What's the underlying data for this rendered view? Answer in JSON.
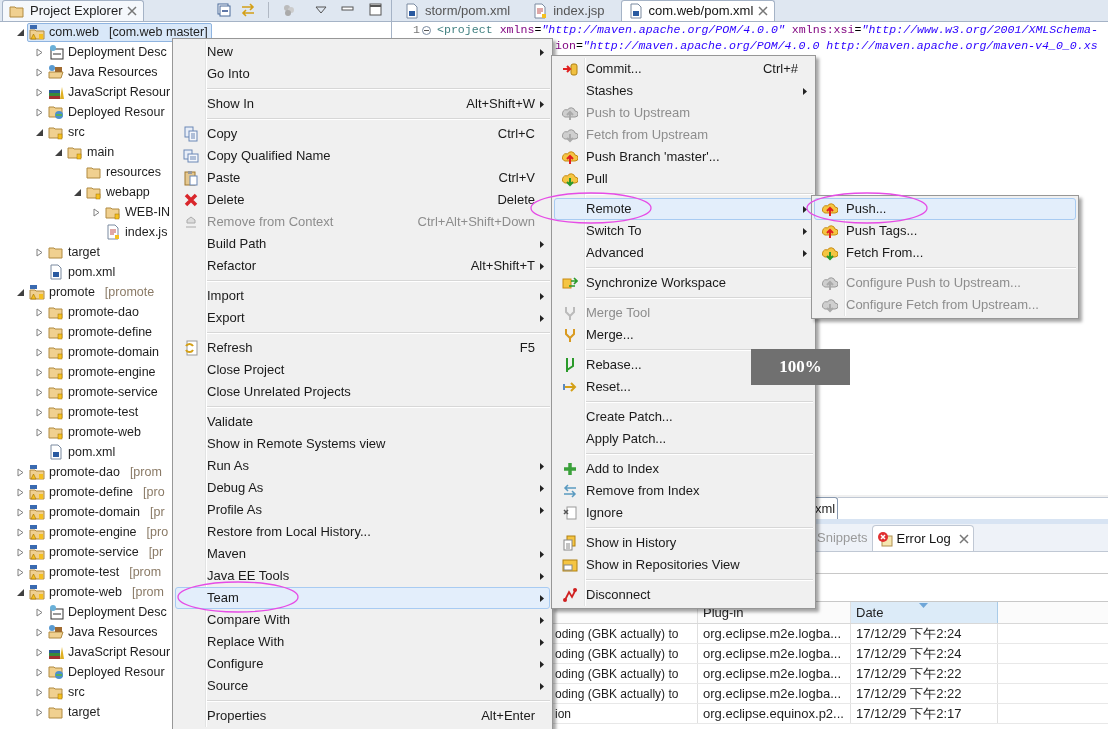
{
  "explorer": {
    "title": "Project Explorer",
    "tree": [
      {
        "label": "com.web",
        "decoration": "[com.web master]",
        "kind": "project",
        "expanded": true,
        "selected": true,
        "children": [
          {
            "label": "Deployment Desc",
            "kind": "deployment-descriptor",
            "expanded": false,
            "selected": false
          },
          {
            "label": "Java Resources",
            "kind": "java-resources",
            "expanded": false,
            "selected": false
          },
          {
            "label": "JavaScript Resour",
            "kind": "javascript-resources",
            "expanded": false,
            "selected": false
          },
          {
            "label": "Deployed Resour",
            "kind": "deployed-resources",
            "expanded": false,
            "selected": false
          },
          {
            "label": "src",
            "kind": "folder",
            "expanded": true,
            "selected": false,
            "children": [
              {
                "label": "main",
                "kind": "folder",
                "expanded": true,
                "selected": false,
                "children": [
                  {
                    "label": "resources",
                    "kind": "plain-folder",
                    "selected": false
                  },
                  {
                    "label": "webapp",
                    "kind": "folder",
                    "expanded": true,
                    "selected": false,
                    "children": [
                      {
                        "label": "WEB-IN",
                        "kind": "folder",
                        "expanded": false,
                        "selected": false
                      },
                      {
                        "label": "index.js",
                        "kind": "jsp-file",
                        "selected": false
                      }
                    ]
                  }
                ]
              }
            ]
          },
          {
            "label": "target",
            "kind": "plain-folder",
            "expanded": false,
            "selected": false
          },
          {
            "label": "pom.xml",
            "kind": "pom-file",
            "selected": false
          }
        ]
      },
      {
        "label": "promote",
        "decoration": "[promote",
        "kind": "project",
        "expanded": true,
        "selected": false,
        "children": [
          {
            "label": "promote-dao",
            "kind": "folder",
            "expanded": false,
            "selected": false
          },
          {
            "label": "promote-define",
            "kind": "folder",
            "expanded": false,
            "selected": false
          },
          {
            "label": "promote-domain",
            "kind": "folder",
            "expanded": false,
            "selected": false
          },
          {
            "label": "promote-engine",
            "kind": "folder",
            "expanded": false,
            "selected": false
          },
          {
            "label": "promote-service",
            "kind": "folder",
            "expanded": false,
            "selected": false
          },
          {
            "label": "promote-test",
            "kind": "folder",
            "expanded": false,
            "selected": false
          },
          {
            "label": "promote-web",
            "kind": "folder",
            "expanded": false,
            "selected": false
          },
          {
            "label": "pom.xml",
            "kind": "pom-file",
            "selected": false
          }
        ]
      },
      {
        "label": "promote-dao",
        "decoration": "[prom",
        "kind": "project",
        "expanded": false,
        "selected": false
      },
      {
        "label": "promote-define",
        "decoration": "[pro",
        "kind": "project",
        "expanded": false,
        "selected": false
      },
      {
        "label": "promote-domain",
        "decoration": "[pr",
        "kind": "project",
        "expanded": false,
        "selected": false
      },
      {
        "label": "promote-engine",
        "decoration": "[pro",
        "kind": "project",
        "expanded": false,
        "selected": false
      },
      {
        "label": "promote-service",
        "decoration": "[pr",
        "kind": "project",
        "expanded": false,
        "selected": false
      },
      {
        "label": "promote-test",
        "decoration": "[prom",
        "kind": "project",
        "expanded": false,
        "selected": false
      },
      {
        "label": "promote-web",
        "decoration": "[prom",
        "kind": "project",
        "expanded": true,
        "selected": false,
        "children": [
          {
            "label": "Deployment Desc",
            "kind": "deployment-descriptor",
            "expanded": false,
            "selected": false
          },
          {
            "label": "Java Resources",
            "kind": "java-resources",
            "expanded": false,
            "selected": false
          },
          {
            "label": "JavaScript Resour",
            "kind": "javascript-resources",
            "expanded": false,
            "selected": false
          },
          {
            "label": "Deployed Resour",
            "kind": "deployed-resources",
            "expanded": false,
            "selected": false
          },
          {
            "label": "src",
            "kind": "folder",
            "expanded": false,
            "selected": false
          },
          {
            "label": "target",
            "kind": "plain-folder",
            "expanded": false,
            "selected": false
          }
        ]
      }
    ]
  },
  "editor": {
    "tabs": [
      {
        "label": "storm/pom.xml",
        "kind": "pom-file",
        "selected": false
      },
      {
        "label": "index.jsp",
        "kind": "jsp-file",
        "selected": false
      },
      {
        "label": "com.web/pom.xml",
        "kind": "pom-file",
        "selected": true
      }
    ],
    "lines": [
      {
        "number": "1",
        "segments": [
          {
            "kind": "tag",
            "text": "<project"
          },
          {
            "kind": "attr",
            "text": " xmlns"
          },
          {
            "kind": "plain",
            "text": "="
          },
          {
            "kind": "string",
            "text": "\"http://maven.apache.org/POM/4.0.0\""
          },
          {
            "kind": "attr",
            "text": " xmlns:xsi"
          },
          {
            "kind": "plain",
            "text": "="
          },
          {
            "kind": "string",
            "text": "\"http://www.w3.org/2001/XMLSchema-"
          }
        ]
      },
      {
        "segments": [
          {
            "kind": "attr",
            "text": "ion"
          },
          {
            "kind": "plain",
            "text": "="
          },
          {
            "kind": "string",
            "text": "\"http://maven.apache.org/POM/4.0.0 http://maven.apache.org/maven-v4_0_0.xs"
          }
        ]
      }
    ],
    "page_tabs": [
      {
        "label": "xml",
        "selected": true
      }
    ]
  },
  "bottom_panel": {
    "tabs": [
      {
        "label": "Snippets",
        "selected": false
      },
      {
        "label": "Error Log",
        "selected": true
      }
    ],
    "columns": [
      {
        "sorted": false
      },
      {
        "label": "Plug-in",
        "sorted": false
      },
      {
        "label": "Date",
        "sorted": true
      }
    ],
    "rows": [
      [
        "oding (GBK actually) to",
        "org.eclipse.m2e.logba...",
        "17/12/29 下午2:24"
      ],
      [
        "oding (GBK actually) to",
        "org.eclipse.m2e.logba...",
        "17/12/29 下午2:24"
      ],
      [
        "oding (GBK actually) to",
        "org.eclipse.m2e.logba...",
        "17/12/29 下午2:22"
      ],
      [
        "oding (GBK actually) to",
        "org.eclipse.m2e.logba...",
        "17/12/29 下午2:22"
      ],
      [
        "ion",
        "org.eclipse.equinox.p2...",
        "17/12/29 下午2:17"
      ]
    ]
  },
  "context_menu": {
    "items": [
      {
        "kind": "item",
        "label": "New",
        "submenu": true,
        "disabled": false,
        "selected": false,
        "circled": false
      },
      {
        "kind": "item",
        "label": "Go Into",
        "submenu": false,
        "disabled": false,
        "selected": false,
        "circled": false
      },
      {
        "kind": "separator"
      },
      {
        "kind": "item",
        "label": "Show In",
        "shortcut": "Alt+Shift+W",
        "submenu": true,
        "disabled": false,
        "selected": false,
        "circled": false
      },
      {
        "kind": "separator"
      },
      {
        "kind": "item",
        "label": "Copy",
        "shortcut": "Ctrl+C",
        "submenu": false,
        "disabled": false,
        "selected": false,
        "circled": false
      },
      {
        "kind": "item",
        "label": "Copy Qualified Name",
        "submenu": false,
        "disabled": false,
        "selected": false,
        "circled": false
      },
      {
        "kind": "item",
        "label": "Paste",
        "shortcut": "Ctrl+V",
        "submenu": false,
        "disabled": false,
        "selected": false,
        "circled": false
      },
      {
        "kind": "item",
        "label": "Delete",
        "shortcut": "Delete",
        "submenu": false,
        "disabled": false,
        "selected": false,
        "circled": false
      },
      {
        "kind": "item",
        "label": "Remove from Context",
        "shortcut": "Ctrl+Alt+Shift+Down",
        "submenu": false,
        "disabled": true,
        "selected": false,
        "circled": false
      },
      {
        "kind": "item",
        "label": "Build Path",
        "submenu": true,
        "disabled": false,
        "selected": false,
        "circled": false
      },
      {
        "kind": "item",
        "label": "Refactor",
        "shortcut": "Alt+Shift+T",
        "submenu": true,
        "disabled": false,
        "selected": false,
        "circled": false
      },
      {
        "kind": "separator"
      },
      {
        "kind": "item",
        "label": "Import",
        "submenu": true,
        "disabled": false,
        "selected": false,
        "circled": false
      },
      {
        "kind": "item",
        "label": "Export",
        "submenu": true,
        "disabled": false,
        "selected": false,
        "circled": false
      },
      {
        "kind": "separator"
      },
      {
        "kind": "item",
        "label": "Refresh",
        "shortcut": "F5",
        "submenu": false,
        "disabled": false,
        "selected": false,
        "circled": false
      },
      {
        "kind": "item",
        "label": "Close Project",
        "submenu": false,
        "disabled": false,
        "selected": false,
        "circled": false
      },
      {
        "kind": "item",
        "label": "Close Unrelated Projects",
        "submenu": false,
        "disabled": false,
        "selected": false,
        "circled": false
      },
      {
        "kind": "separator"
      },
      {
        "kind": "item",
        "label": "Validate",
        "submenu": false,
        "disabled": false,
        "selected": false,
        "circled": false
      },
      {
        "kind": "item",
        "label": "Show in Remote Systems view",
        "submenu": false,
        "disabled": false,
        "selected": false,
        "circled": false
      },
      {
        "kind": "item",
        "label": "Run As",
        "submenu": true,
        "disabled": false,
        "selected": false,
        "circled": false
      },
      {
        "kind": "item",
        "label": "Debug As",
        "submenu": true,
        "disabled": false,
        "selected": false,
        "circled": false
      },
      {
        "kind": "item",
        "label": "Profile As",
        "submenu": true,
        "disabled": false,
        "selected": false,
        "circled": false
      },
      {
        "kind": "item",
        "label": "Restore from Local History...",
        "submenu": false,
        "disabled": false,
        "selected": false,
        "circled": false
      },
      {
        "kind": "item",
        "label": "Maven",
        "submenu": true,
        "disabled": false,
        "selected": false,
        "circled": false
      },
      {
        "kind": "item",
        "label": "Java EE Tools",
        "submenu": true,
        "disabled": false,
        "selected": false,
        "circled": false
      },
      {
        "kind": "item",
        "label": "Team",
        "submenu": true,
        "disabled": false,
        "selected": true,
        "circled": true
      },
      {
        "kind": "item",
        "label": "Compare With",
        "submenu": true,
        "disabled": false,
        "selected": false,
        "circled": false
      },
      {
        "kind": "item",
        "label": "Replace With",
        "submenu": true,
        "disabled": false,
        "selected": false,
        "circled": false
      },
      {
        "kind": "item",
        "label": "Configure",
        "submenu": true,
        "disabled": false,
        "selected": false,
        "circled": false
      },
      {
        "kind": "item",
        "label": "Source",
        "submenu": true,
        "disabled": false,
        "selected": false,
        "circled": false
      },
      {
        "kind": "separator"
      },
      {
        "kind": "item",
        "label": "Properties",
        "shortcut": "Alt+Enter",
        "submenu": false,
        "disabled": false,
        "selected": false,
        "circled": false
      }
    ]
  },
  "team_menu": {
    "items": [
      {
        "kind": "item",
        "label": "Commit...",
        "shortcut": "Ctrl+#",
        "submenu": false,
        "disabled": false,
        "selected": false,
        "circled": false
      },
      {
        "kind": "item",
        "label": "Stashes",
        "submenu": true,
        "disabled": false,
        "selected": false,
        "circled": false
      },
      {
        "kind": "item",
        "label": "Push to Upstream",
        "submenu": false,
        "disabled": true,
        "selected": false,
        "circled": false
      },
      {
        "kind": "item",
        "label": "Fetch from Upstream",
        "submenu": false,
        "disabled": true,
        "selected": false,
        "circled": false
      },
      {
        "kind": "item",
        "label": "Push Branch 'master'...",
        "submenu": false,
        "disabled": false,
        "selected": false,
        "circled": false
      },
      {
        "kind": "item",
        "label": "Pull",
        "submenu": false,
        "disabled": false,
        "selected": false,
        "circled": false
      },
      {
        "kind": "separator"
      },
      {
        "kind": "item",
        "label": "Remote",
        "submenu": true,
        "disabled": false,
        "selected": true,
        "circled": true
      },
      {
        "kind": "item",
        "label": "Switch To",
        "submenu": true,
        "disabled": false,
        "selected": false,
        "circled": false
      },
      {
        "kind": "item",
        "label": "Advanced",
        "submenu": true,
        "disabled": false,
        "selected": false,
        "circled": false
      },
      {
        "kind": "separator"
      },
      {
        "kind": "item",
        "label": "Synchronize Workspace",
        "submenu": false,
        "disabled": false,
        "selected": false,
        "circled": false
      },
      {
        "kind": "separator"
      },
      {
        "kind": "item",
        "label": "Merge Tool",
        "submenu": false,
        "disabled": true,
        "selected": false,
        "circled": false
      },
      {
        "kind": "item",
        "label": "Merge...",
        "submenu": false,
        "disabled": false,
        "selected": false,
        "circled": false
      },
      {
        "kind": "separator"
      },
      {
        "kind": "item",
        "label": "Rebase...",
        "disabled": false,
        "selected": false,
        "circled": false
      },
      {
        "kind": "item",
        "label": "Reset...",
        "submenu": false,
        "disabled": false,
        "selected": false,
        "circled": false
      },
      {
        "kind": "separator"
      },
      {
        "kind": "item",
        "label": "Create Patch...",
        "submenu": false,
        "disabled": false,
        "selected": false,
        "circled": false
      },
      {
        "kind": "item",
        "label": "Apply Patch...",
        "submenu": false,
        "disabled": false,
        "selected": false,
        "circled": false
      },
      {
        "kind": "separator"
      },
      {
        "kind": "item",
        "label": "Add to Index",
        "submenu": false,
        "disabled": false,
        "selected": false,
        "circled": false
      },
      {
        "kind": "item",
        "label": "Remove from Index",
        "submenu": false,
        "disabled": false,
        "selected": false,
        "circled": false
      },
      {
        "kind": "item",
        "label": "Ignore",
        "submenu": false,
        "disabled": false,
        "selected": false,
        "circled": false
      },
      {
        "kind": "separator"
      },
      {
        "kind": "item",
        "label": "Show in History",
        "submenu": false,
        "disabled": false,
        "selected": false,
        "circled": false
      },
      {
        "kind": "item",
        "label": "Show in Repositories View",
        "submenu": false,
        "disabled": false,
        "selected": false,
        "circled": false
      },
      {
        "kind": "separator"
      },
      {
        "kind": "item",
        "label": "Disconnect",
        "submenu": false,
        "disabled": false,
        "selected": false,
        "circled": false
      }
    ]
  },
  "remote_menu": {
    "items": [
      {
        "kind": "item",
        "label": "Push...",
        "submenu": false,
        "disabled": false,
        "selected": true,
        "circled": true
      },
      {
        "kind": "item",
        "label": "Push Tags...",
        "submenu": false,
        "disabled": false,
        "selected": false,
        "circled": false
      },
      {
        "kind": "item",
        "label": "Fetch From...",
        "submenu": false,
        "disabled": false,
        "selected": false,
        "circled": false
      },
      {
        "kind": "separator"
      },
      {
        "kind": "item",
        "label": "Configure Push to Upstream...",
        "submenu": false,
        "disabled": true,
        "selected": false,
        "circled": false
      },
      {
        "kind": "item",
        "label": "Configure Fetch from Upstream...",
        "submenu": false,
        "disabled": true,
        "selected": false,
        "circled": false
      }
    ]
  },
  "zoom_indicator": "100%"
}
